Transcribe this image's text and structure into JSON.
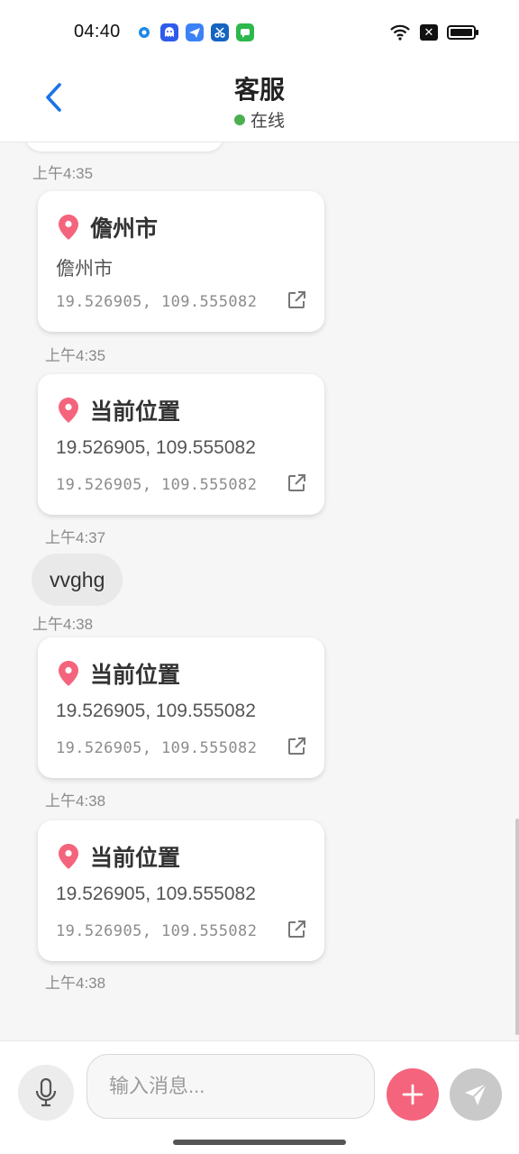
{
  "status_bar": {
    "time": "04:40",
    "apps": [
      "browser-app-icon",
      "ghost-app-icon",
      "plane-app-icon",
      "scissors-app-icon",
      "chat-app-icon"
    ],
    "right_icons": [
      "wifi-icon",
      "close-box-icon",
      "battery-icon"
    ]
  },
  "header": {
    "back_icon": "chevron-left-icon",
    "title": "客服",
    "status": "在线",
    "status_color": "#4caf50",
    "accent_color": "#1a73e8"
  },
  "messages": [
    {
      "type": "timestamp",
      "text": "上午4:35"
    },
    {
      "type": "location",
      "title": "儋州市",
      "subtitle": "儋州市",
      "coords": "19.526905, 109.555082"
    },
    {
      "type": "timestamp",
      "text": "上午4:35"
    },
    {
      "type": "location",
      "title": "当前位置",
      "subtitle": "19.526905, 109.555082",
      "coords": "19.526905, 109.555082"
    },
    {
      "type": "timestamp",
      "text": "上午4:37"
    },
    {
      "type": "text",
      "text": "vvghg"
    },
    {
      "type": "timestamp",
      "text": "上午4:38"
    },
    {
      "type": "location",
      "title": "当前位置",
      "subtitle": "19.526905, 109.555082",
      "coords": "19.526905, 109.555082"
    },
    {
      "type": "timestamp",
      "text": "上午4:38"
    },
    {
      "type": "location",
      "title": "当前位置",
      "subtitle": "19.526905, 109.555082",
      "coords": "19.526905, 109.555082"
    },
    {
      "type": "timestamp",
      "text": "上午4:38"
    }
  ],
  "input_bar": {
    "placeholder": "输入消息...",
    "mic_icon": "microphone-icon",
    "plus_icon": "plus-icon",
    "send_icon": "send-icon",
    "plus_color": "#f4647c",
    "send_color": "#c9c9c9"
  },
  "pin_color": "#f4647c"
}
